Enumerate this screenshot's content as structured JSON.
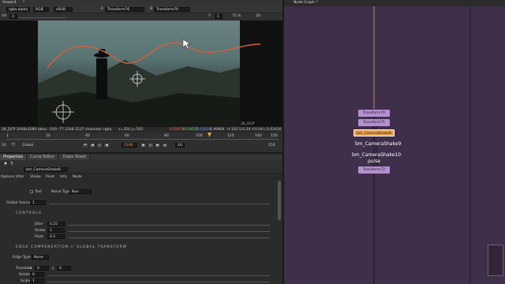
{
  "viewer": {
    "title": "Viewer1",
    "close": "×",
    "toolbar": {
      "channel": "rgba.alpha",
      "space": "RGB",
      "colorspace": "sRGB",
      "input_a_prefix": "A",
      "input_a": "Transform76",
      "input_b_prefix": "B",
      "input_b": "Transform76",
      "frame": "f/8",
      "gain": "1",
      "y": "Y",
      "gamma": "1",
      "zoom": "75.%",
      "mode": "2D"
    },
    "format_label": "2K_DCP",
    "status_line": "2K_DCP 2048x1080  bbox: -100 -77 2248 1237 channels: rgba",
    "coords": "x=354 y=561",
    "pixel_values": [
      "0.02676",
      "0.03655",
      "0.03624",
      "1.99904"
    ],
    "hsvl": "H:102 S:0.29 V:0.04",
    "luma": "L:0.03426",
    "timeline": {
      "fps": "24",
      "tt": "TT",
      "global": "Global",
      "ticks": [
        "1",
        "10",
        "40",
        "60",
        "80",
        "100",
        "120",
        "140",
        "150"
      ],
      "current_frame": "1100",
      "step": "10",
      "end_frame": "150"
    }
  },
  "properties": {
    "tabs": [
      "Properties",
      "Curve Editor",
      "Dope Sheet"
    ],
    "node_name": "bm_CameraShake8",
    "subtabs": [
      "Jitter",
      "Shake",
      "Pivot",
      "Info",
      "Node"
    ],
    "side_label": "Options",
    "test_label": "Test",
    "noise_type_label": "Noise Type",
    "noise_type_value": "Non",
    "global_amount_label": "Global Amount",
    "global_amount_value": "1",
    "controls_header": "CONTROLS",
    "jitter_label": "Jitter",
    "jitter_value": "0.25",
    "shake_label": "Shake",
    "shake_value": "1",
    "pivot_label": "Pivot",
    "pivot_value": "0.2",
    "edge_header": "EDGE COMPENSATION // GLOBAL TRANSFORM",
    "edge_type_label": "Edge Type",
    "edge_type_value": "None",
    "translate_label": "Translate",
    "translate_x_prefix": "x",
    "translate_x": "0",
    "translate_y_prefix": "y",
    "translate_y": "0",
    "rotate_label": "Rotate",
    "rotate_value": "0",
    "scale_label": "Scale",
    "scale_value": "1"
  },
  "node_graph": {
    "title": "Node Graph",
    "close": "×",
    "nodes": [
      {
        "label": "Transform70",
        "color": "#b58fd1"
      },
      {
        "label": "Transform71",
        "color": "#b58fd1"
      },
      {
        "label": "bm_CameraShake8",
        "color": "#e8a04c"
      },
      {
        "label": "bm_CameraShake9",
        "color": "#ffffff"
      },
      {
        "label": "bm_CameraShake10",
        "color": "#ffffff"
      },
      {
        "label": "pulse",
        "color": "#ffffff"
      },
      {
        "label": "Transform72",
        "color": "#b58fd1"
      }
    ]
  },
  "colors": {
    "graph_bg": "#3f2f4a",
    "panel_bg": "#2b2b2b",
    "accent_orange": "#e8a04c",
    "node_purple": "#b58fd1"
  }
}
